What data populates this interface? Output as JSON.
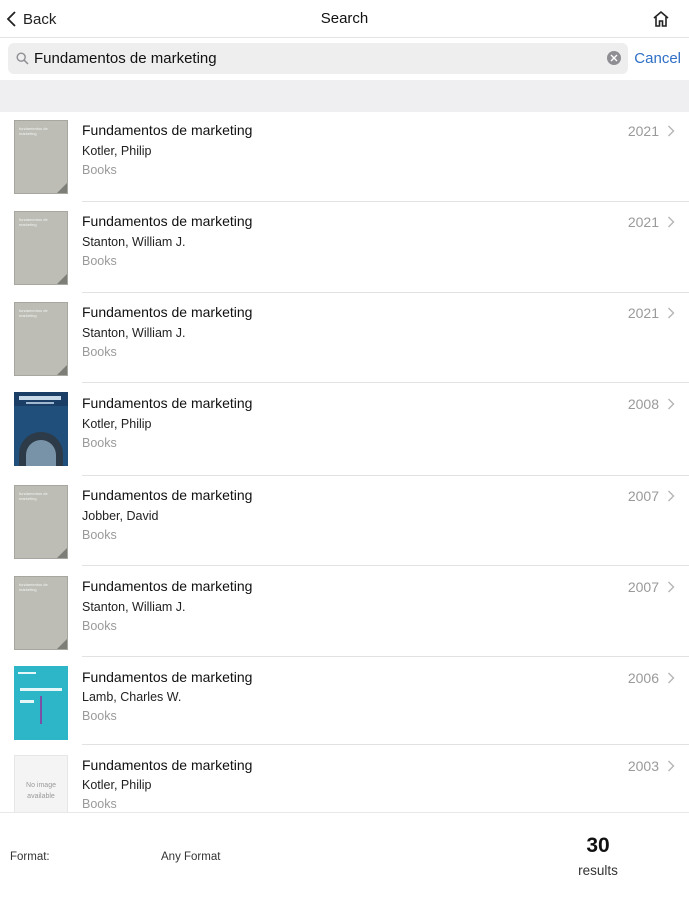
{
  "nav": {
    "back_label": "Back",
    "title": "Search",
    "back_icon": "chevron-left-icon",
    "home_icon": "home-icon"
  },
  "search": {
    "value": "Fundamentos de marketing",
    "cancel_label": "Cancel",
    "search_icon": "magnifier-icon",
    "clear_icon": "clear-x-icon"
  },
  "results": [
    {
      "title": "Fundamentos de marketing",
      "author": "Kotler, Philip",
      "format": "Books",
      "year": "2021",
      "cover": "gray",
      "cover_text": "fundamentos de marketing"
    },
    {
      "title": "Fundamentos de marketing",
      "author": "Stanton, William J.",
      "format": "Books",
      "year": "2021",
      "cover": "gray",
      "cover_text": "fundamentos de marketing"
    },
    {
      "title": "Fundamentos de marketing",
      "author": "Stanton, William J.",
      "format": "Books",
      "year": "2021",
      "cover": "gray",
      "cover_text": "fundamentos de marketing"
    },
    {
      "title": "Fundamentos de marketing",
      "author": "Kotler, Philip",
      "format": "Books",
      "year": "2008",
      "cover": "blue",
      "cover_text": ""
    },
    {
      "title": "Fundamentos de marketing",
      "author": "Jobber, David",
      "format": "Books",
      "year": "2007",
      "cover": "gray",
      "cover_text": "fundamentos de marketing"
    },
    {
      "title": "Fundamentos de marketing",
      "author": "Stanton, William J.",
      "format": "Books",
      "year": "2007",
      "cover": "gray",
      "cover_text": "fundamentos de marketing"
    },
    {
      "title": "Fundamentos de marketing",
      "author": "Lamb, Charles W.",
      "format": "Books",
      "year": "2006",
      "cover": "teal",
      "cover_text": ""
    },
    {
      "title": "Fundamentos de marketing",
      "author": "Kotler, Philip",
      "format": "Books",
      "year": "2003",
      "cover": "noimg",
      "cover_text": "No image available"
    }
  ],
  "footer": {
    "format_label": "Format:",
    "format_value": "Any Format",
    "count": "30",
    "count_label": "results"
  },
  "colors": {
    "accent": "#2f6fc5",
    "secondary_text": "#9a9a9a",
    "band": "#efeff2"
  }
}
